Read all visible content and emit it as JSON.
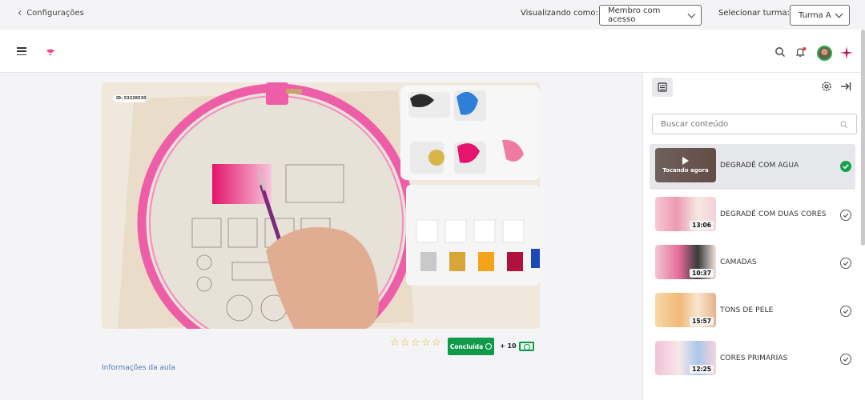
{
  "topbar": {
    "back_label": "Configurações",
    "view_as_label": "Visualizando como:",
    "view_as_value": "Membro com acesso",
    "class_label": "Selecionar turma:",
    "class_value": "Turma A"
  },
  "header": {
    "icons": [
      "menu-icon",
      "logo",
      "search-icon",
      "bell-icon",
      "avatar",
      "sparkle-icon"
    ],
    "notification_dot_color": "#e53935",
    "brand_color": "#c2185b"
  },
  "video": {
    "id_badge": "ID: 53228530"
  },
  "lesson_actions": {
    "rating_stars": 5,
    "rating_value": 0,
    "done_label": "Concluída",
    "points_label": "+ 10",
    "info_link": "Informações da aula"
  },
  "sidebar": {
    "search_placeholder": "Buscar conteúdo",
    "lessons": [
      {
        "title": "DEGRADÊ COM AGUA",
        "duration": "",
        "now_playing": "Tocando agora",
        "completed": true,
        "active": true
      },
      {
        "title": "DEGRADÊ COM DUAS CORES",
        "duration": "13:06",
        "completed": false
      },
      {
        "title": "CAMADAS",
        "duration": "10:37",
        "completed": false
      },
      {
        "title": "TONS DE PELE",
        "duration": "15:57",
        "completed": false
      },
      {
        "title": "CORES PRIMARIAS",
        "duration": "12:25",
        "completed": false
      }
    ]
  },
  "colors": {
    "accent_green": "#11994a",
    "pink_hoop": "#ee5ea8",
    "link_blue": "#4f79b8"
  }
}
